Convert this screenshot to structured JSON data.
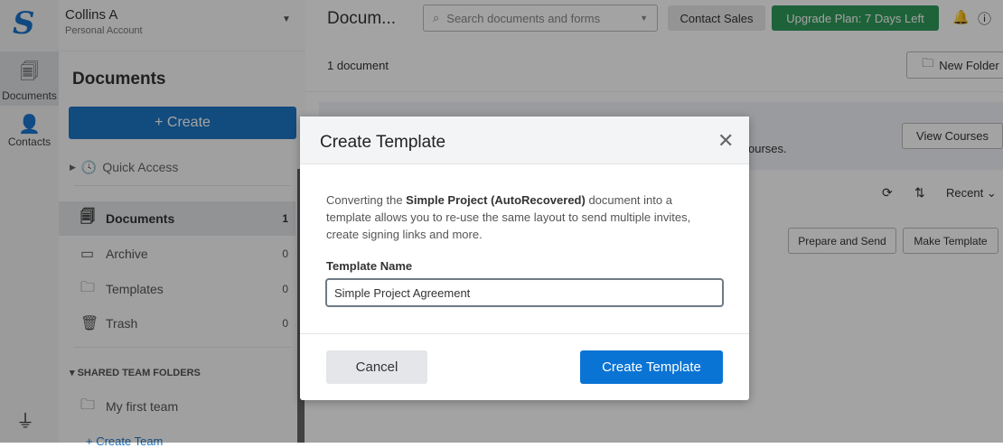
{
  "rail": {
    "items": [
      {
        "label": "Documents",
        "icon": "documents-icon"
      },
      {
        "label": "Contacts",
        "icon": "contacts-icon"
      }
    ]
  },
  "account": {
    "name": "Collins A",
    "type": "Personal Account"
  },
  "sidebar": {
    "title": "Documents",
    "create_label": "+ Create",
    "quick_access": "Quick Access",
    "items": [
      {
        "label": "Documents",
        "count": "1"
      },
      {
        "label": "Archive",
        "count": "0"
      },
      {
        "label": "Templates",
        "count": "0"
      },
      {
        "label": "Trash",
        "count": "0"
      }
    ],
    "shared_header": "SHARED TEAM FOLDERS",
    "team": "My first team",
    "create_team": "+ Create Team"
  },
  "header": {
    "title": "Docum...",
    "search_placeholder": "Search documents and forms",
    "contact_sales": "Contact Sales",
    "upgrade": "Upgrade Plan: 7 Days Left"
  },
  "main": {
    "count": "1 document",
    "new_folder": "New Folder",
    "banner_text": "ourses.",
    "view_courses": "View Courses",
    "sort": "Recent",
    "prepare_send": "Prepare and Send",
    "make_template": "Make Template"
  },
  "modal": {
    "title": "Create Template",
    "desc_pre": "Converting the ",
    "doc_name": "Simple Project (AutoRecovered)",
    "desc_post": " document into a template allows you to re-use the same layout to send multiple invites, create signing links and more.",
    "field_label": "Template Name",
    "field_value": "Simple Project Agreement",
    "cancel": "Cancel",
    "submit": "Create Template"
  },
  "colors": {
    "primary": "#0a74d4",
    "upgrade": "#2f9a5c"
  }
}
